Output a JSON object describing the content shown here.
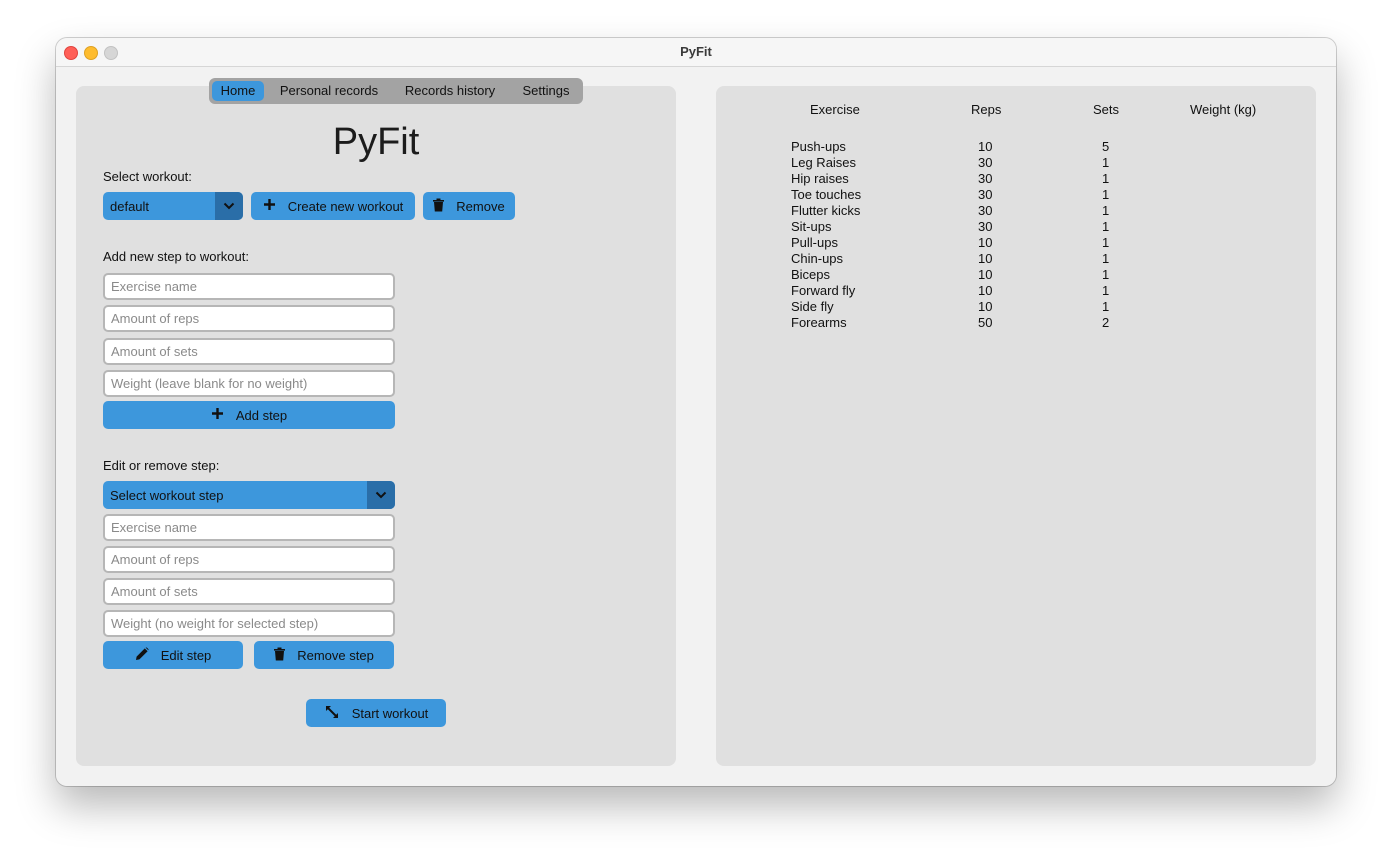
{
  "window": {
    "title": "PyFit"
  },
  "tabs": [
    {
      "label": "Home",
      "active": true
    },
    {
      "label": "Personal records",
      "active": false
    },
    {
      "label": "Records history",
      "active": false
    },
    {
      "label": "Settings",
      "active": false
    }
  ],
  "app_title": "PyFit",
  "select_workout": {
    "label": "Select workout:",
    "value": "default",
    "create_label": "Create new workout",
    "remove_label": "Remove"
  },
  "add_step": {
    "label": "Add new step to workout:",
    "exercise_placeholder": "Exercise name",
    "reps_placeholder": "Amount of reps",
    "sets_placeholder": "Amount of sets",
    "weight_placeholder": "Weight (leave blank for no weight)",
    "button_label": "Add step"
  },
  "edit_step": {
    "label": "Edit or remove step:",
    "select_value": "Select workout step",
    "exercise_placeholder": "Exercise name",
    "reps_placeholder": "Amount of reps",
    "sets_placeholder": "Amount of sets",
    "weight_placeholder": "Weight (no weight for selected step)",
    "edit_label": "Edit step",
    "remove_label": "Remove step"
  },
  "start_label": "Start workout",
  "table": {
    "headers": [
      "Exercise",
      "Reps",
      "Sets",
      "Weight (kg)"
    ],
    "rows": [
      [
        "Push-ups",
        "10",
        "5",
        ""
      ],
      [
        "Leg Raises",
        "30",
        "1",
        ""
      ],
      [
        "Hip raises",
        "30",
        "1",
        ""
      ],
      [
        "Toe touches",
        "30",
        "1",
        ""
      ],
      [
        "Flutter kicks",
        "30",
        "1",
        ""
      ],
      [
        "Sit-ups",
        "30",
        "1",
        ""
      ],
      [
        "Pull-ups",
        "10",
        "1",
        ""
      ],
      [
        "Chin-ups",
        "10",
        "1",
        ""
      ],
      [
        "Biceps",
        "10",
        "1",
        ""
      ],
      [
        "Forward fly",
        "10",
        "1",
        ""
      ],
      [
        "Side fly",
        "10",
        "1",
        ""
      ],
      [
        "Forearms",
        "50",
        "2",
        ""
      ]
    ]
  },
  "colors": {
    "accent": "#3d97dc",
    "accent_dark": "#2a6ea8",
    "panel": "#e0e0e0"
  },
  "icons": {
    "plus": "plus-icon",
    "trash": "trash-icon",
    "pencil": "pencil-icon",
    "expand": "expand-icon",
    "chevron": "chevron-down-icon"
  }
}
